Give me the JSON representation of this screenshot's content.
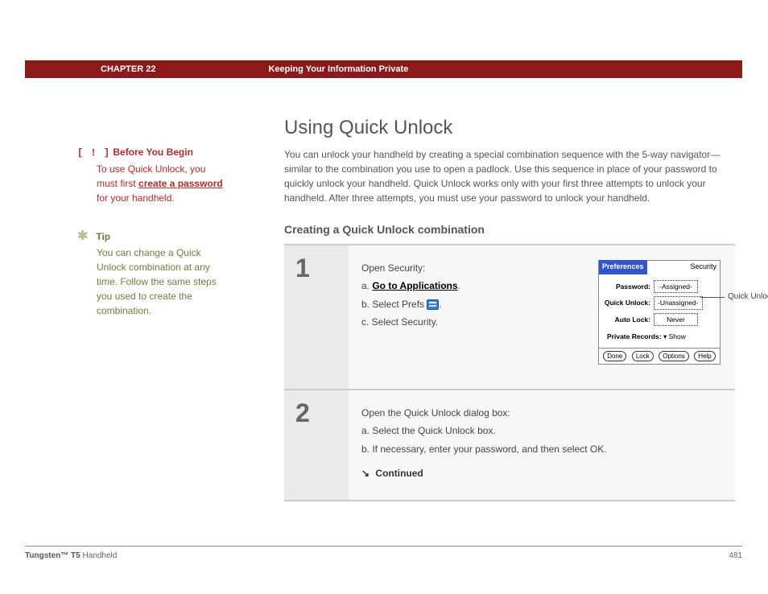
{
  "header": {
    "chapter": "CHAPTER 22",
    "title": "Keeping Your Information Private"
  },
  "sidebar": {
    "before": {
      "heading": "Before You Begin",
      "text1": "To use Quick Unlock, you must first ",
      "link": "create a password",
      "text2": " for your handheld."
    },
    "tip": {
      "heading": "Tip",
      "body": "You can change a Quick Unlock combination at any time. Follow the same steps you used to create the combination."
    }
  },
  "main": {
    "h1": "Using Quick Unlock",
    "intro": "You can unlock your handheld by creating a special combination sequence with the 5-way navigator—similar to the combination you use to open a padlock. Use this sequence in place of your password to quickly unlock your handheld. Quick Unlock works only with your first three attempts to unlock your handheld. After three attempts, you must use your password to unlock your handheld.",
    "h2": "Creating a Quick Unlock combination"
  },
  "steps": {
    "s1": {
      "num": "1",
      "lead": "Open Security:",
      "a_prefix": "a.  ",
      "a_link": "Go to Applications",
      "a_suffix": ".",
      "b": "b.  Select Prefs ",
      "b_suffix": ".",
      "c": "c.  Select Security."
    },
    "s2": {
      "num": "2",
      "lead": "Open the Quick Unlock dialog box:",
      "a": "a.  Select the Quick Unlock box.",
      "b": "b.  If necessary, enter your password, and then select OK.",
      "continued": "Continued"
    }
  },
  "handheld": {
    "titleLeft": "Preferences",
    "titleRight": "Security",
    "rows": {
      "passwordLabel": "Password:",
      "passwordVal": "-Assigned-",
      "quickLabel": "Quick Unlock:",
      "quickVal": "-Unassigned-",
      "autoLabel": "Auto Lock:",
      "autoVal": "Never"
    },
    "privateLabel": "Private Records:",
    "privateVal": "Show",
    "buttons": {
      "done": "Done",
      "lock": "Lock",
      "options": "Options",
      "help": "Help"
    },
    "callout": "Quick Unlock box"
  },
  "footer": {
    "productBold": "Tungsten™ T5",
    "productRest": " Handheld",
    "page": "481"
  }
}
